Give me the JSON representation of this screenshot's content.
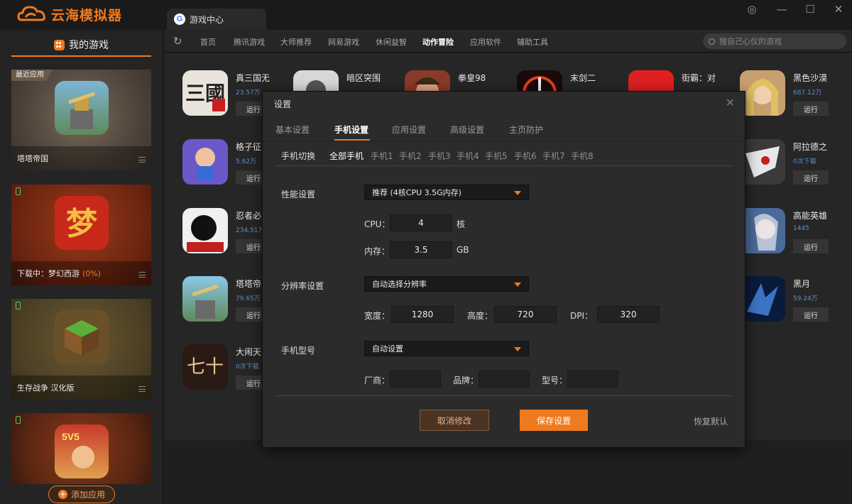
{
  "app": {
    "title": "云海模拟器",
    "tab_title": "游戏中心"
  },
  "sidebar": {
    "header": "我的游戏",
    "recent_tag": "最近应用",
    "cards": [
      {
        "label": "塔塔帝国"
      },
      {
        "label": "下载中：梦幻西游",
        "progress": "(0%)"
      },
      {
        "label": "生存战争 汉化版"
      },
      {
        "label": ""
      }
    ],
    "add_button": "添加应用"
  },
  "nav": {
    "items": [
      "首页",
      "腾讯游戏",
      "大师推荐",
      "网易游戏",
      "休闲益智",
      "动作冒险",
      "应用软件",
      "辅助工具"
    ],
    "active": "动作冒险",
    "search_placeholder": "搜自己心仪的游戏"
  },
  "games": {
    "run_label": "运行",
    "list": [
      {
        "name": "真三国无",
        "count": "23.57万"
      },
      {
        "name": "暗区突围",
        "count": ""
      },
      {
        "name": "拳皇98",
        "count": ""
      },
      {
        "name": "末剑二",
        "count": ""
      },
      {
        "name": "街霸：对",
        "count": ""
      },
      {
        "name": "黑色沙漠",
        "count": "687.12万"
      },
      {
        "name": "格子征战",
        "count": "5.62万"
      },
      {
        "name": "阿拉德之",
        "count": "0次下载"
      },
      {
        "name": "忍者必须",
        "count": "234.51万"
      },
      {
        "name": "高能英雄",
        "count": "1445"
      },
      {
        "name": "塔塔帝国",
        "count": "79.65万"
      },
      {
        "name": "黑月",
        "count": "59.24万"
      },
      {
        "name": "大闹天宫",
        "count": "0次下载"
      }
    ]
  },
  "dialog": {
    "title": "设置",
    "tabs": [
      "基本设置",
      "手机设置",
      "应用设置",
      "高级设置",
      "主页防护"
    ],
    "active_tab": "手机设置",
    "phone_switch_label": "手机切换",
    "phones": [
      "全部手机",
      "手机1",
      "手机2",
      "手机3",
      "手机4",
      "手机5",
      "手机6",
      "手机7",
      "手机8"
    ],
    "performance": {
      "label": "性能设置",
      "selected": "推荐 (4核CPU 3.5G内存)",
      "cpu_label": "CPU：",
      "cpu_value": "4",
      "cpu_unit": "核",
      "mem_label": "内存：",
      "mem_value": "3.5",
      "mem_unit": "GB"
    },
    "resolution": {
      "label": "分辨率设置",
      "selected": "自动选择分辨率",
      "width_label": "宽度：",
      "width": "1280",
      "height_label": "高度：",
      "height": "720",
      "dpi_label": "DPI：",
      "dpi": "320"
    },
    "model": {
      "label": "手机型号",
      "selected": "自动设置",
      "vendor_label": "厂商：",
      "brand_label": "品牌：",
      "model_label": "型号："
    },
    "cancel": "取消修改",
    "save": "保存设置",
    "restore": "恢复默认"
  },
  "colors": {
    "accent": "#f07a1e",
    "count_blue": "#5a8fc8"
  }
}
